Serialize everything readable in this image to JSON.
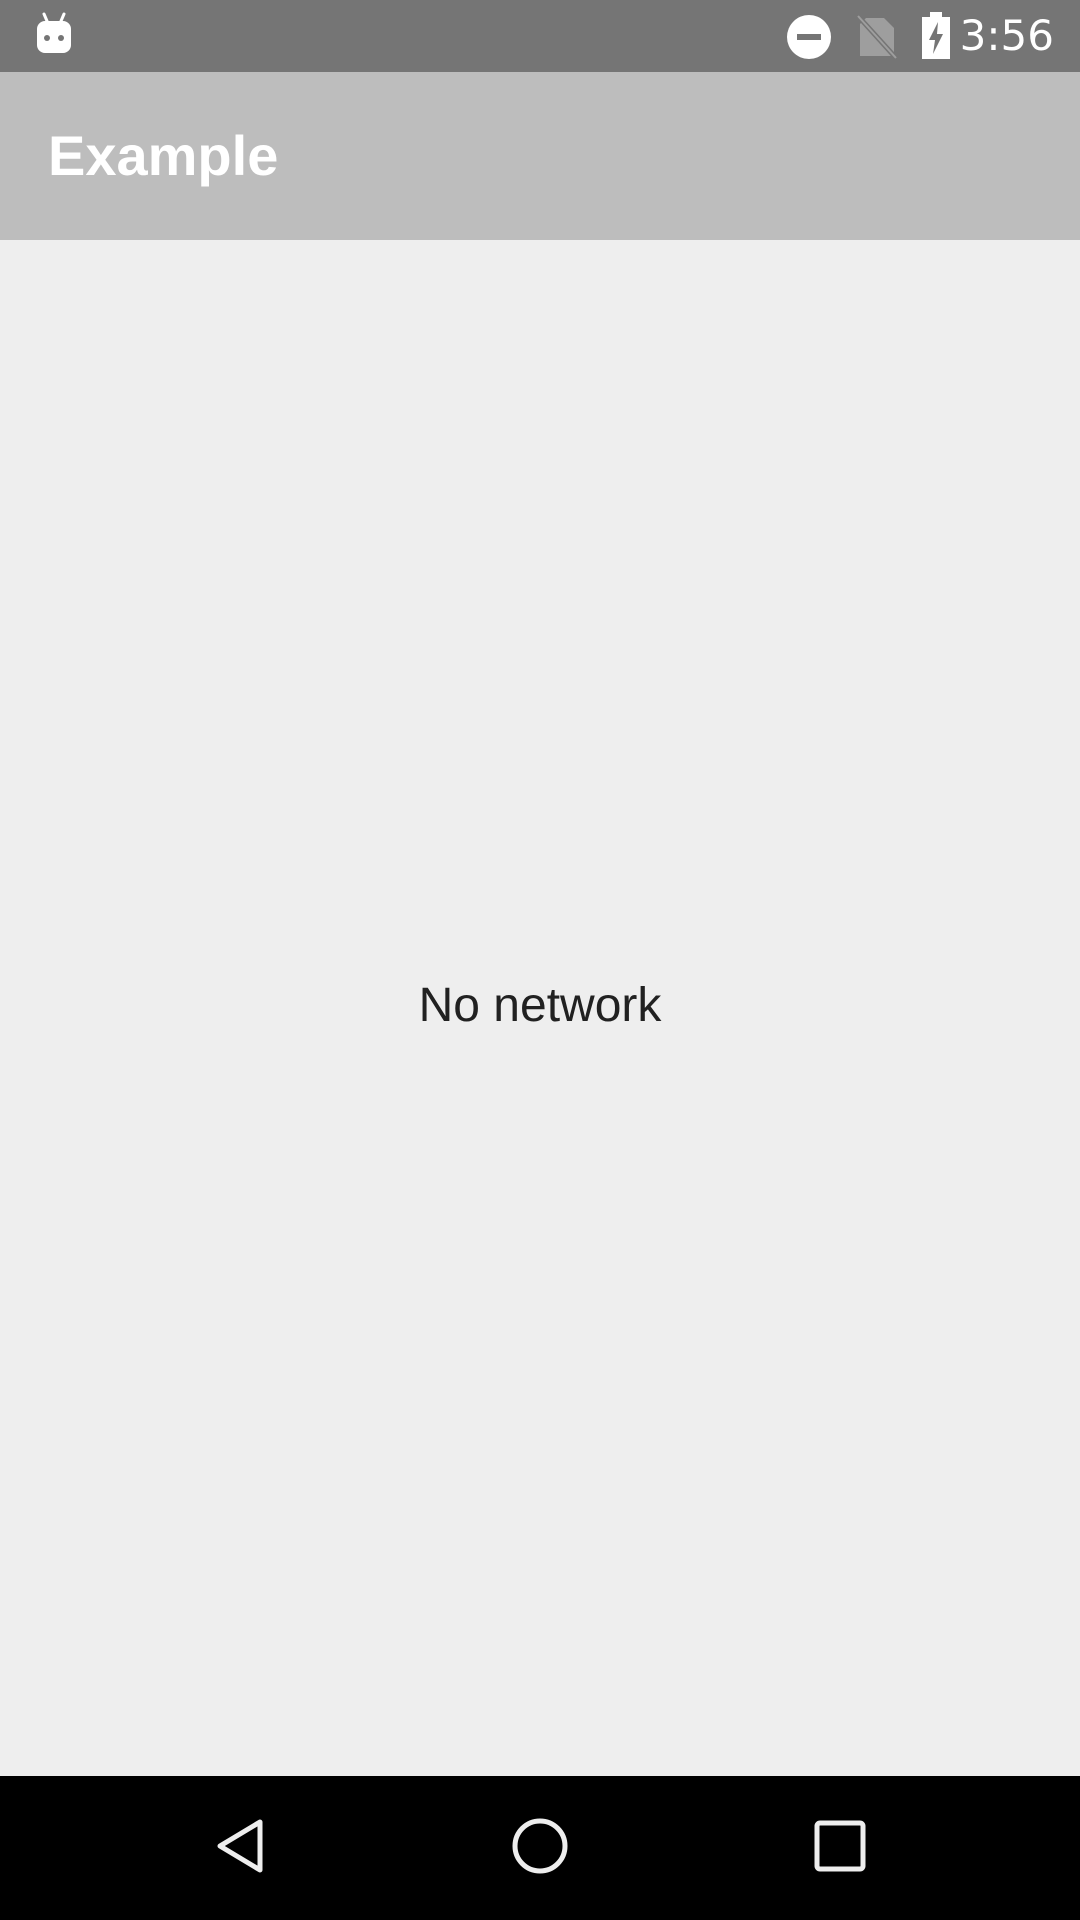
{
  "status_bar": {
    "notification_icon": "android-icon",
    "dnd_icon": "do-not-disturb-icon",
    "sim_icon": "no-sim-icon",
    "battery_icon": "battery-charging-icon",
    "time": "3:56"
  },
  "app_bar": {
    "title": "Example"
  },
  "content": {
    "message": "No network"
  },
  "nav_bar": {
    "back_icon": "back-icon",
    "home_icon": "home-icon",
    "recents_icon": "recents-icon"
  },
  "colors": {
    "status_bar": "#757575",
    "app_bar": "#bdbdbd",
    "background": "#eeeeee",
    "nav_bar": "#000000",
    "text_primary": "#212121"
  }
}
